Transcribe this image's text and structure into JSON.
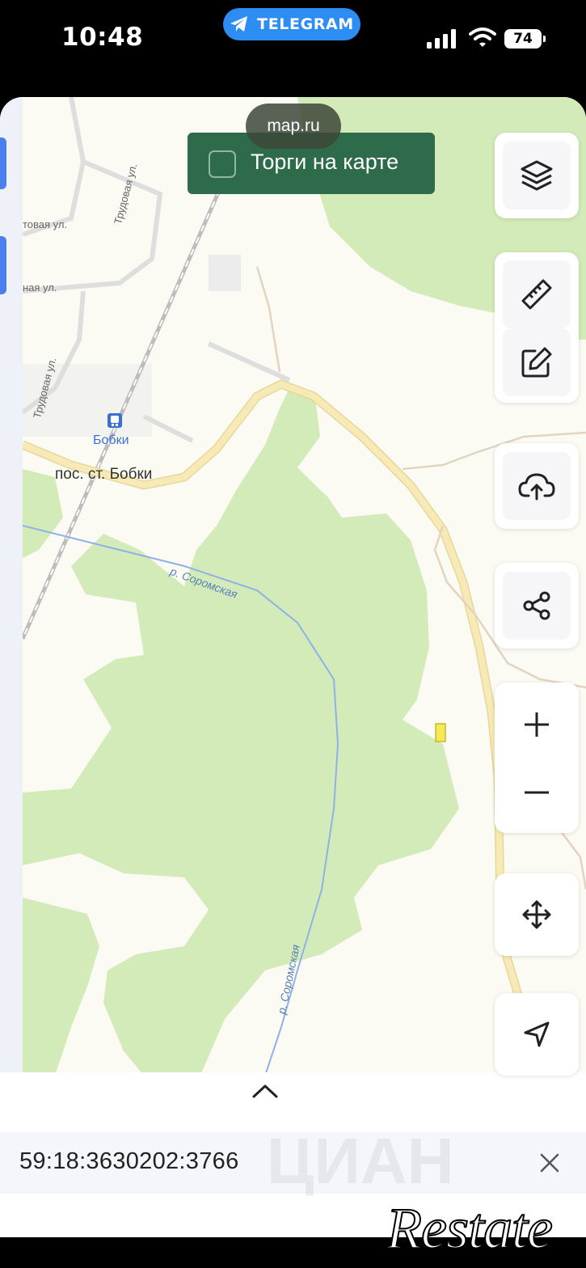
{
  "status_bar": {
    "time": "10:48",
    "app_pill": "TELEGRAM",
    "battery": "74"
  },
  "map": {
    "source_pill": "map.ru",
    "torgi_toggle_label": "Торги на карте",
    "street_labels": [
      "товая ул.",
      "Трудовая ул.",
      "ная ул.",
      "Трудовая ул."
    ],
    "station_label": "Бобки",
    "place_label": "пос. ст. Бобки",
    "river_labels": [
      "р. Соромская",
      "р. Соромская"
    ]
  },
  "controls": [
    "layers-icon",
    "ruler-icon",
    "edit-icon",
    "upload-cloud-icon",
    "share-icon",
    "zoom-in-icon",
    "zoom-out-icon",
    "move-icon",
    "locate-icon"
  ],
  "bottom_sheet": {
    "cadastral_number": "59:18:3630202:3766"
  },
  "watermark": "Restate",
  "colors": {
    "forest": "#d3ebb9",
    "road": "#f6e2a3",
    "river": "#8fb1e8",
    "torgi_bg": "#2e6b4a",
    "accent": "#2e8df2"
  }
}
